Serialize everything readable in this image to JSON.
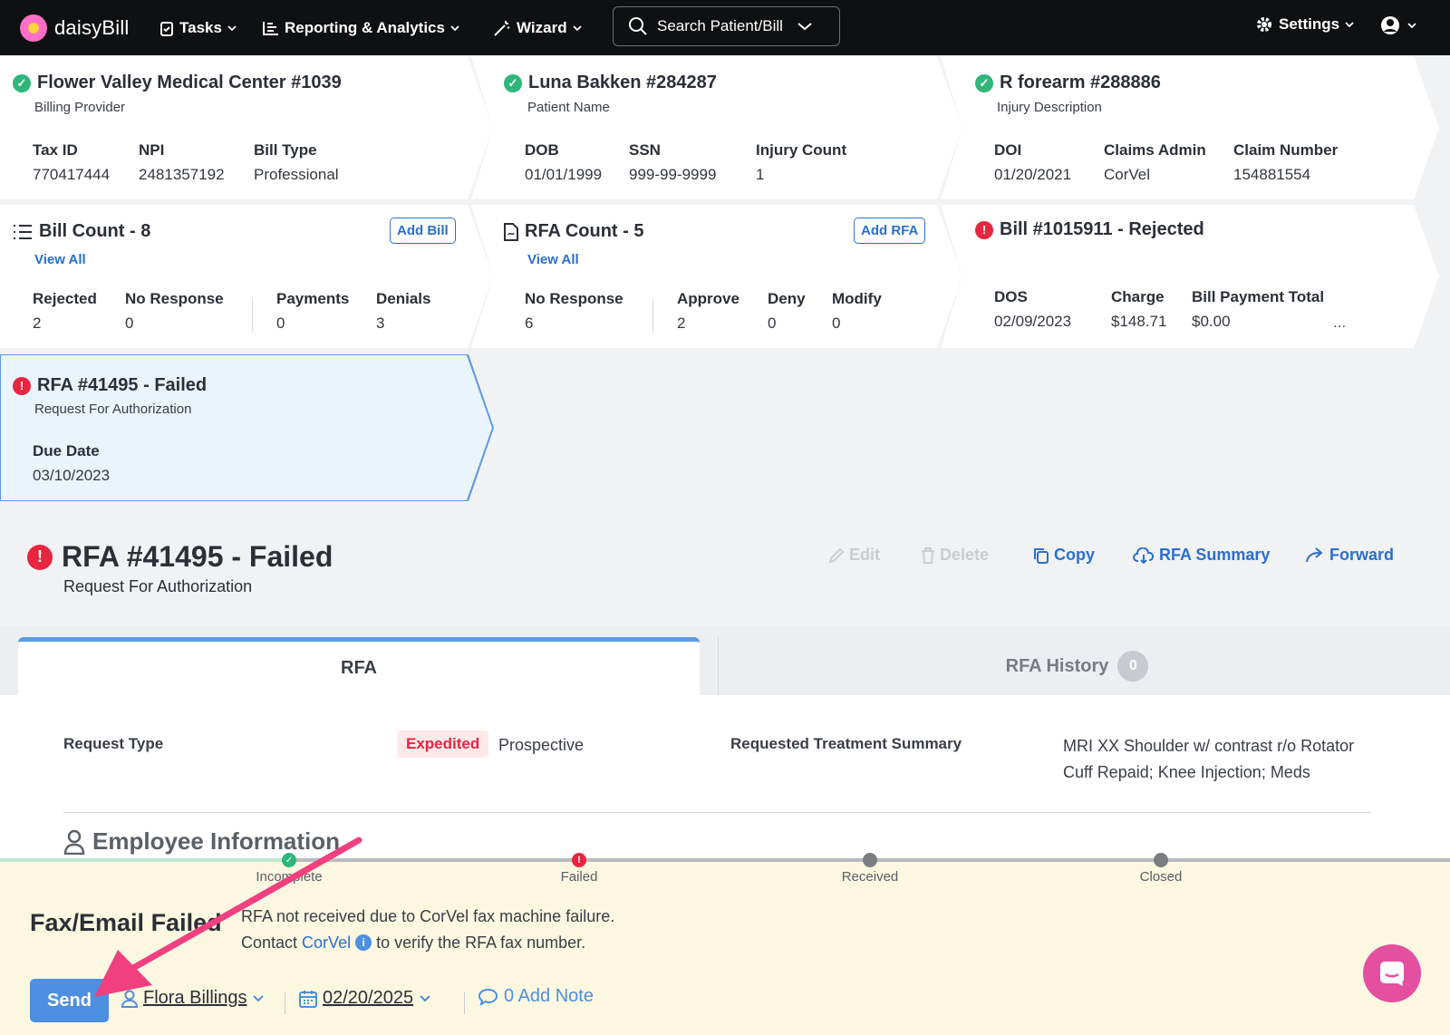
{
  "brand": {
    "name": "daisyBill"
  },
  "nav": {
    "tasks": "Tasks",
    "reporting": "Reporting & Analytics",
    "wizard": "Wizard",
    "search": "Search Patient/Bill",
    "settings": "Settings"
  },
  "provider": {
    "title": "Flower Valley Medical Center #1039",
    "subtitle": "Billing Provider",
    "fields": [
      {
        "label": "Tax ID",
        "value": "770417444"
      },
      {
        "label": "NPI",
        "value": "2481357192"
      },
      {
        "label": "Bill Type",
        "value": "Professional"
      }
    ]
  },
  "patient": {
    "title": "Luna Bakken #284287",
    "subtitle": "Patient Name",
    "fields": [
      {
        "label": "DOB",
        "value": "01/01/1999"
      },
      {
        "label": "SSN",
        "value": "999-99-9999"
      },
      {
        "label": "Injury Count",
        "value": "1"
      }
    ]
  },
  "injury": {
    "title": "R forearm #288886",
    "subtitle": "Injury Description",
    "fields": [
      {
        "label": "DOI",
        "value": "01/20/2021"
      },
      {
        "label": "Claims Admin",
        "value": "CorVel"
      },
      {
        "label": "Claim Number",
        "value": "154881554"
      }
    ]
  },
  "bills": {
    "title": "Bill Count - 8",
    "view_all": "View All",
    "add": "Add Bill",
    "fields": [
      {
        "label": "Rejected",
        "value": "2"
      },
      {
        "label": "No Response",
        "value": "0"
      },
      {
        "label": "Payments",
        "value": "0"
      },
      {
        "label": "Denials",
        "value": "3"
      }
    ]
  },
  "rfas": {
    "title": "RFA Count - 5",
    "view_all": "View All",
    "add": "Add RFA",
    "fields": [
      {
        "label": "No Response",
        "value": "6"
      },
      {
        "label": "Approve",
        "value": "2"
      },
      {
        "label": "Deny",
        "value": "0"
      },
      {
        "label": "Modify",
        "value": "0"
      }
    ]
  },
  "bill_card": {
    "title": "Bill #1015911 - Rejected",
    "ellipsis": "...",
    "fields": [
      {
        "label": "DOS",
        "value": "02/09/2023"
      },
      {
        "label": "Charge",
        "value": "$148.71"
      },
      {
        "label": "Bill Payment Total",
        "value": "$0.00"
      }
    ]
  },
  "rfa_card": {
    "title": "RFA #41495 - Failed",
    "subtitle": "Request For Authorization",
    "due_label": "Due Date",
    "due_value": "03/10/2023"
  },
  "page": {
    "title": "RFA #41495 - Failed",
    "subtitle": "Request For Authorization",
    "actions": {
      "edit": "Edit",
      "delete": "Delete",
      "copy": "Copy",
      "summary": "RFA Summary",
      "forward": "Forward"
    }
  },
  "tabs": {
    "rfa": "RFA",
    "history": "RFA History",
    "history_count": "0"
  },
  "details": {
    "request_type_label": "Request Type",
    "expedited": "Expedited",
    "prospective": "Prospective",
    "summary_label": "Requested Treatment Summary",
    "summary_line1": "MRI XX Shoulder w/ contrast r/o Rotator",
    "summary_line2": "Cuff Repaid; Knee Injection; Meds",
    "employee_heading": "Employee Information"
  },
  "progress": {
    "steps": [
      "Incomplete",
      "Failed",
      "Received",
      "Closed"
    ]
  },
  "status": {
    "title": "Fax/Email Failed",
    "line1": "RFA not received due to CorVel fax machine failure.",
    "line2_pre": "Contact",
    "line2_link": "CorVel",
    "line2_post": "to verify the RFA fax number.",
    "send": "Send",
    "assignee": "Flora Billings",
    "date": "02/20/2025",
    "note": "0 Add Note"
  },
  "colors": {
    "accent": "#2b6fd0",
    "success": "#2fb67b",
    "error": "#e8253f",
    "callout_arrow": "#f0407f"
  }
}
